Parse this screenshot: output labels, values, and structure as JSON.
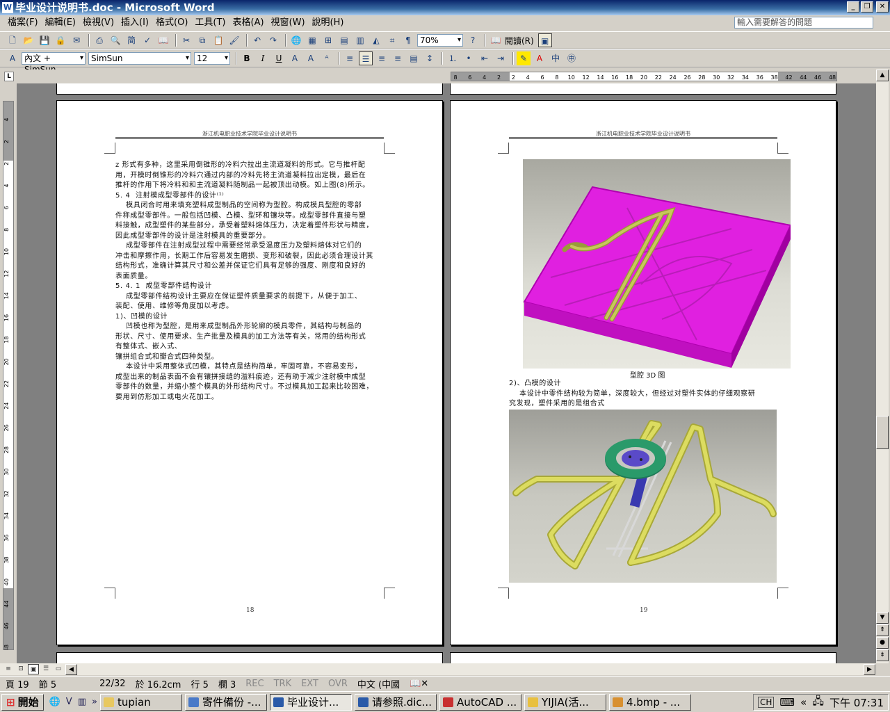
{
  "window": {
    "title": "毕业设计说明书.doc - Microsoft Word",
    "app_icon": "W",
    "buttons": [
      "_",
      "❐",
      "✕"
    ]
  },
  "menu": [
    "檔案(F)",
    "編輯(E)",
    "檢視(V)",
    "插入(I)",
    "格式(O)",
    "工具(T)",
    "表格(A)",
    "視窗(W)",
    "說明(H)"
  ],
  "help_box": {
    "placeholder": "輸入需要解答的問題"
  },
  "toolbar1": {
    "zoom": "70%",
    "reading_button": "閱讀(R)"
  },
  "toolbar2": {
    "style": "內文 + SimSun",
    "font": "SimSun",
    "size": "12",
    "bold": "B",
    "italic": "I",
    "underline": "U"
  },
  "ruler": {
    "horizontal_ticks": [
      "8",
      "6",
      "4",
      "2",
      "2",
      "4",
      "6",
      "8",
      "10",
      "12",
      "14",
      "16",
      "18",
      "20",
      "22",
      "24",
      "26",
      "28",
      "30",
      "32",
      "34",
      "36",
      "38",
      "42",
      "44",
      "46",
      "48"
    ],
    "vertical_ticks": [
      "4",
      "2",
      "2",
      "4",
      "6",
      "8",
      "10",
      "12",
      "14",
      "16",
      "18",
      "20",
      "22",
      "24",
      "26",
      "28",
      "30",
      "32",
      "34",
      "36",
      "38",
      "40",
      "44",
      "46",
      "48"
    ]
  },
  "page18": {
    "header": "浙江机电职业技术学院毕业设计说明书",
    "lines": [
      "z 形式有多种，这里采用倒锥形的冷料穴拉出主流道凝料的形式。它与推杆配",
      "用，开模时倒锥形的冷料穴通过内部的冷料先将主流道凝料拉出定模，最后在",
      "推杆的作用下将冷料和和主流道凝料随制品一起被顶出动模。如上图(8)所示。",
      "5. 4  注射模成型零部件的设计⁽¹⁾",
      "    模具闭合时用来填充塑料成型制品的空间称为型腔。构成模具型腔的零部",
      "件称成型零部件。一般包括凹模、凸模、型环和镶块等。成型零部件直接与塑",
      "料接触，成型塑件的某些部分，承受着塑料熔体压力，决定着塑件形状与精度，",
      "因此成型零部件的设计是注射模具的重要部分。",
      "    成型零部件在注射成型过程中需要经常承受温度压力及塑料熔体对它们的",
      "冲击和摩擦作用，长期工作后容易发生磨损、变形和破裂，因此必须合理设计其",
      "结构形式，准确计算其尺寸和公差并保证它们具有足够的强度、刚度和良好的",
      "表面质量。",
      "5. 4. 1  成型零部件结构设计",
      "    成型零部件结构设计主要应在保证塑件质量要求的前提下，从便于加工、",
      "装配、使用、维修等角度加以考虑。",
      "1)、凹模的设计",
      "    凹模也称为型腔，是用来成型制品外形轮廓的模具零件，其结构与制品的",
      "形状、尺寸、使用要求、生产批量及模具的加工方法等有关，常用的结构形式",
      "有整体式、嵌入式、",
      "镶拼组合式和瓣合式四种类型。",
      "    本设计中采用整体式凹模，其特点是结构简单，牢固可靠，不容易变形，",
      "成型出来的制品表面不会有镶拼接缝的溢料痕迹，还有助于减少注射模中成型",
      "零部件的数量，并缩小整个模具的外形结构尺寸。不过模具加工起来比较困难，",
      "要用到仿形加工或电火花加工。"
    ],
    "page_number": "18"
  },
  "page19": {
    "header": "浙江机电职业技术学院毕业设计说明书",
    "figure1_caption": "型腔 3D 图",
    "lines": [
      "2)、凸模的设计",
      "    本设计中零件结构较为简单，深度较大，但经过对塑件实体的仔细观察研",
      "究发现，塑件采用的是组合式"
    ],
    "page_number": "19"
  },
  "status": {
    "page": "頁 19",
    "section": "節 5",
    "of": "22/32",
    "at": "於 16.2cm",
    "line": "行 5",
    "col": "欄 3",
    "rec": "REC",
    "trk": "TRK",
    "ext": "EXT",
    "ovr": "OVR",
    "lang": "中文 (中國"
  },
  "taskbar": {
    "start": "開始",
    "items": [
      {
        "label": "tupian",
        "color": "#e8c860"
      },
      {
        "label": "寄件備份 -...",
        "color": "#4a7ac8"
      },
      {
        "label": "毕业设计...",
        "color": "#2a5aa8"
      },
      {
        "label": "请参照.dic...",
        "color": "#2a5aa8"
      },
      {
        "label": "AutoCAD ...",
        "color": "#c83030"
      },
      {
        "label": "YIJIA(活...",
        "color": "#e8c040"
      },
      {
        "label": "4.bmp - ...",
        "color": "#d89030"
      }
    ],
    "lang": "CH",
    "clock": "下午 07:31"
  }
}
